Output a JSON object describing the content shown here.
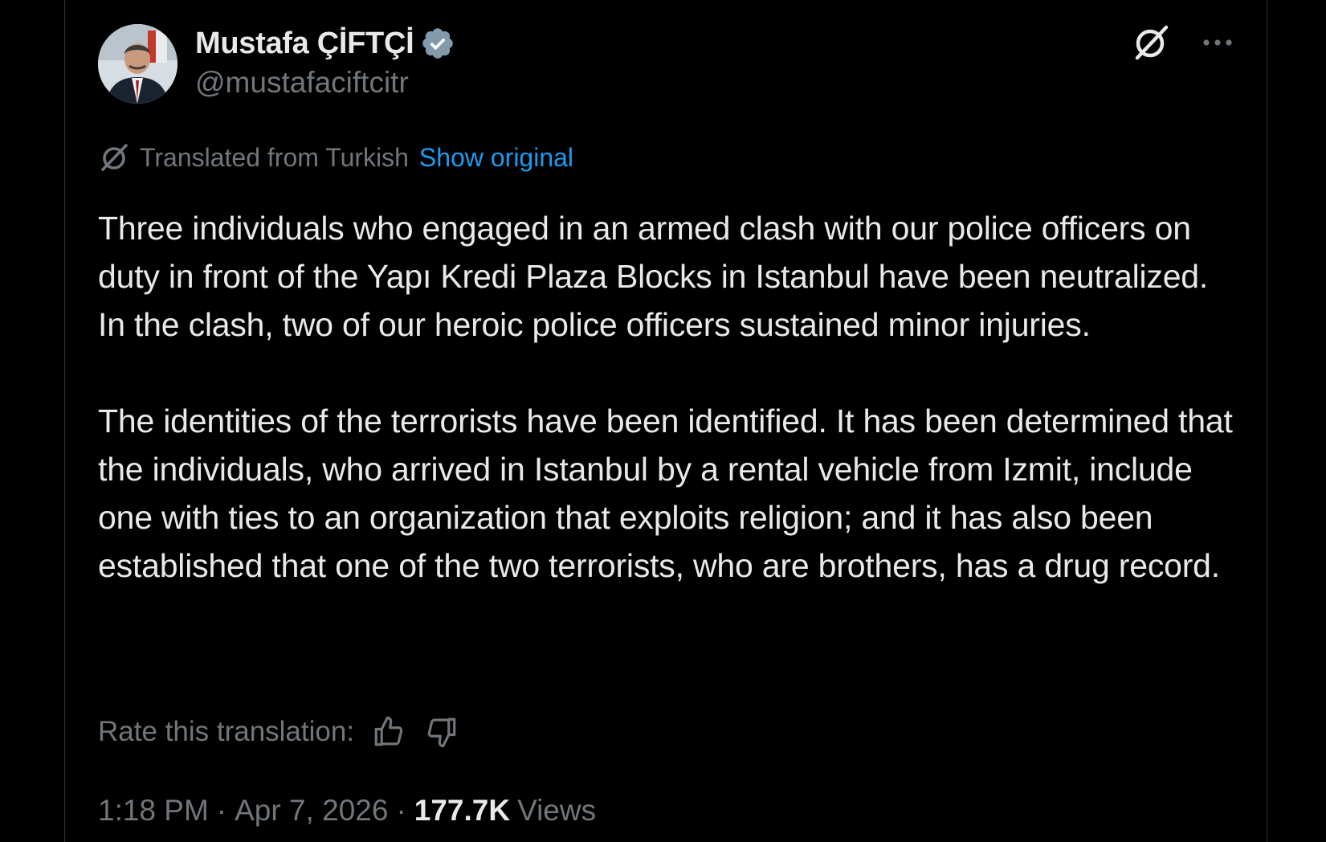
{
  "author": {
    "display_name": "Mustafa ÇİFTÇİ",
    "handle": "@mustafaciftcitr",
    "verified_badge_icon": "verified-badge-icon",
    "verified_color": "#829aab"
  },
  "header_actions": {
    "grok_icon": "grok-icon",
    "more_icon": "more-options-icon"
  },
  "translation": {
    "label": "Translated from Turkish",
    "show_original_label": "Show original",
    "link_color": "#1d9bf0"
  },
  "post": {
    "paragraphs": [
      "Three individuals who engaged in an armed clash with our police officers on duty in front of the Yapı Kredi Plaza Blocks in Istanbul have been neutralized. In the clash, two of our heroic police officers sustained minor injuries.",
      "The identities of the terrorists have been identified. It has been determined that the individuals, who arrived in Istanbul by a rental vehicle from Izmit, include one with ties to an organization that exploits religion; and it has also been established that one of the two terrorists, who are brothers, has a drug record."
    ]
  },
  "rating": {
    "label": "Rate this translation:",
    "thumbs_up_icon": "thumbs-up-icon",
    "thumbs_down_icon": "thumbs-down-icon"
  },
  "meta": {
    "time": "1:18 PM",
    "separator": "·",
    "date": "Apr 7, 2026",
    "views_count": "177.7K",
    "views_label": "Views"
  },
  "colors": {
    "background": "#000000",
    "text_primary": "#e7e9ea",
    "text_secondary": "#71767b",
    "border": "#2f3336"
  }
}
